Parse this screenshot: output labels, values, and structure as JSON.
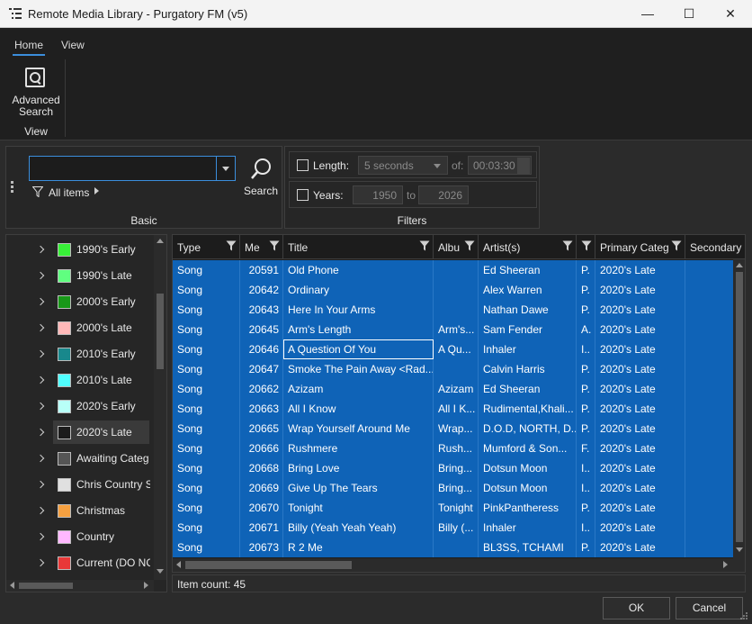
{
  "window": {
    "title": "Remote Media Library - Purgatory FM (v5)",
    "minimize": "—",
    "maximize": "☐",
    "close": "✕"
  },
  "ribbon": {
    "tabs": [
      {
        "label": "Home",
        "active": true
      },
      {
        "label": "View",
        "active": false
      }
    ],
    "advanced_search_label": "Advanced Search",
    "group_label": "View"
  },
  "basic": {
    "search_value": "",
    "all_items_label": "All items",
    "search_button_label": "Search",
    "caption": "Basic"
  },
  "filters": {
    "length_label": "Length:",
    "length_value": "5 seconds",
    "of_label": "of:",
    "of_value": "00:03:30",
    "years_label": "Years:",
    "year_from": "1950",
    "to_label": "to",
    "year_to": "2026",
    "caption": "Filters"
  },
  "categories": [
    {
      "label": "1990's Early",
      "color": "#38f038"
    },
    {
      "label": "1990's Late",
      "color": "#60ff80"
    },
    {
      "label": "2000's Early",
      "color": "#189818"
    },
    {
      "label": "2000's Late",
      "color": "#ffb8b8"
    },
    {
      "label": "2010's Early",
      "color": "#18888c"
    },
    {
      "label": "2010's Late",
      "color": "#50ffff"
    },
    {
      "label": "2020's Early",
      "color": "#b8fff8"
    },
    {
      "label": "2020's Late",
      "color": "#1c1c1c",
      "selected": true
    },
    {
      "label": "Awaiting Categ",
      "color": "#555555"
    },
    {
      "label": "Chris Country S",
      "color": "#e0e0e0"
    },
    {
      "label": "Christmas",
      "color": "#f5a040"
    },
    {
      "label": "Country",
      "color": "#ffb8ff"
    },
    {
      "label": "Current (DO NC",
      "color": "#e83838"
    }
  ],
  "grid": {
    "columns": [
      {
        "label": "Type"
      },
      {
        "label": "Me"
      },
      {
        "label": "Title"
      },
      {
        "label": "Albu"
      },
      {
        "label": "Artist(s)"
      },
      {
        "label": ""
      },
      {
        "label": "Primary Categ"
      },
      {
        "label": "Secondary C"
      }
    ],
    "rows": [
      [
        "Song",
        "20591",
        "Old Phone",
        "",
        "Ed Sheeran",
        "P.",
        "2020's Late"
      ],
      [
        "Song",
        "20642",
        "Ordinary",
        "",
        "Alex Warren",
        "P.",
        "2020's Late"
      ],
      [
        "Song",
        "20643",
        "Here In Your Arms",
        "",
        "Nathan Dawe",
        "P.",
        "2020's Late"
      ],
      [
        "Song",
        "20645",
        "Arm's Length",
        "Arm's...",
        "Sam Fender",
        "A.",
        "2020's Late"
      ],
      [
        "Song",
        "20646",
        "A Question Of You",
        "A Qu...",
        "Inhaler",
        "I..",
        "2020's Late"
      ],
      [
        "Song",
        "20647",
        "Smoke The Pain Away <Rad...",
        "",
        "Calvin Harris",
        "P.",
        "2020's Late"
      ],
      [
        "Song",
        "20662",
        "Azizam",
        "Azizam",
        "Ed Sheeran",
        "P.",
        "2020's Late"
      ],
      [
        "Song",
        "20663",
        "All I Know",
        "All I K...",
        "Rudimental,Khali...",
        "P.",
        "2020's Late"
      ],
      [
        "Song",
        "20665",
        "Wrap Yourself Around Me",
        "Wrap...",
        "D.O.D, NORTH, D...",
        "P.",
        "2020's Late"
      ],
      [
        "Song",
        "20666",
        "Rushmere",
        "Rush...",
        "Mumford & Son...",
        "F.",
        "2020's Late"
      ],
      [
        "Song",
        "20668",
        "Bring Love",
        "Bring...",
        "Dotsun Moon",
        "I..",
        "2020's Late"
      ],
      [
        "Song",
        "20669",
        "Give Up The Tears",
        "Bring...",
        "Dotsun Moon",
        "I..",
        "2020's Late"
      ],
      [
        "Song",
        "20670",
        "Tonight",
        "Tonight",
        "PinkPantheress",
        "P.",
        "2020's Late"
      ],
      [
        "Song",
        "20671",
        "Billy (Yeah Yeah Yeah)",
        "Billy (...",
        "Inhaler",
        "I..",
        "2020's Late"
      ],
      [
        "Song",
        "20673",
        "R 2 Me",
        "",
        "BL3SS, TCHAMI",
        "P.",
        "2020's Late"
      ]
    ],
    "focus_row": 4
  },
  "status": {
    "item_count": "Item count:  45"
  },
  "buttons": {
    "ok": "OK",
    "cancel": "Cancel"
  },
  "colors": {
    "selection": "#0f63b7",
    "accent": "#3b8edc",
    "background": "#2b2b2b"
  }
}
